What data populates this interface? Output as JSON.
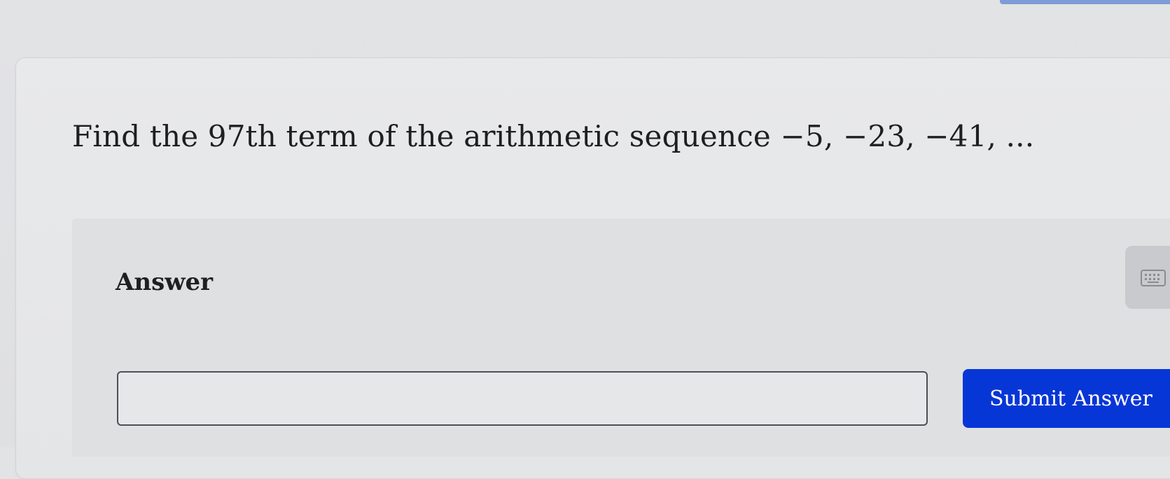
{
  "question": {
    "text": "Find the 97th term of the arithmetic sequence −5, −23, −41, ..."
  },
  "answer": {
    "label": "Answer",
    "input_value": "",
    "input_placeholder": ""
  },
  "toolbar": {
    "keyboard_icon": "keyboard-icon",
    "submit_label": "Submit Answer"
  },
  "colors": {
    "submit_button": "#0736d6",
    "page_background": "#e2e3e5"
  }
}
